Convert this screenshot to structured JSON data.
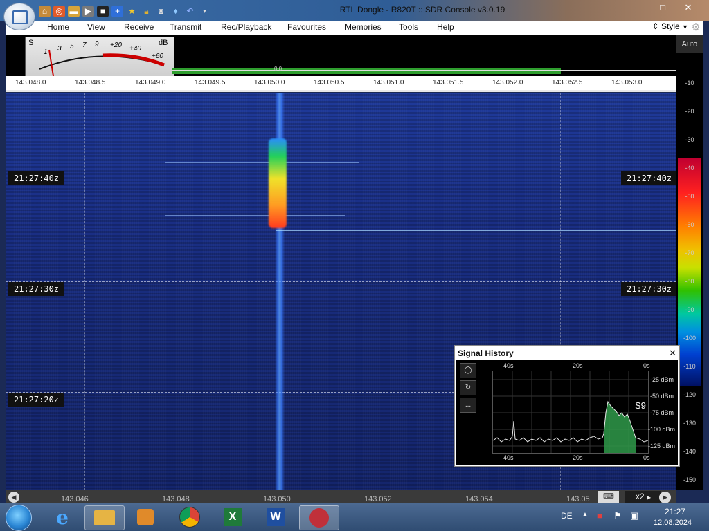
{
  "window": {
    "title": "RTL Dongle - R820T :: SDR Console v3.0.19",
    "minimize": "–",
    "maximize": "□",
    "close": "✕"
  },
  "menu": {
    "items": [
      "Home",
      "View",
      "Receive",
      "Transmit",
      "Rec/Playback",
      "Favourites",
      "Memories",
      "Tools",
      "Help"
    ],
    "style_label": "Style"
  },
  "smeter": {
    "s_label": "S",
    "db_label": "dB",
    "marks": [
      "1",
      "3",
      "5",
      "7",
      "9",
      "+20",
      "+40",
      "+60"
    ]
  },
  "spectrum": {
    "freq_ticks": [
      "143.048.0",
      "143.048.5",
      "143.049.0",
      "143.049.5",
      "143.050.0",
      "143.050.5",
      "143.051.0",
      "143.051.5",
      "143.052.0",
      "143.052.5",
      "143.053.0"
    ],
    "readout": "0.0"
  },
  "db_scale": {
    "auto_label": "Auto",
    "labels": [
      "-10",
      "-20",
      "-30",
      "-40",
      "-50",
      "-60",
      "-70",
      "-80",
      "-90",
      "-100",
      "-110",
      "-120",
      "-130",
      "-140",
      "-150"
    ]
  },
  "waterfall": {
    "timestamps": [
      "21:27:40z",
      "21:27:30z",
      "21:27:20z"
    ]
  },
  "bottom": {
    "freqs": [
      "143.046",
      "143.048",
      "143.050",
      "143.052",
      "143.054",
      "143.05"
    ],
    "zoom_label": "x2"
  },
  "signal_history": {
    "title": "Signal History",
    "close": "✕",
    "time_top": [
      "40s",
      "20s",
      "0s"
    ],
    "time_bottom": [
      "40s",
      "20s",
      "0s"
    ],
    "dbm_labels": [
      "-25 dBm",
      "-50 dBm",
      "-75 dBm",
      "-100 dBm",
      "-125 dBm"
    ],
    "s_level": "S9",
    "tool_more": "..."
  },
  "taskbar": {
    "language": "DE",
    "time": "21:27",
    "date": "12.08.2024"
  },
  "colors": {
    "waterfall_bg": "#1a2f86",
    "signal": "#62a8ff",
    "accent": "#2f5d96"
  }
}
